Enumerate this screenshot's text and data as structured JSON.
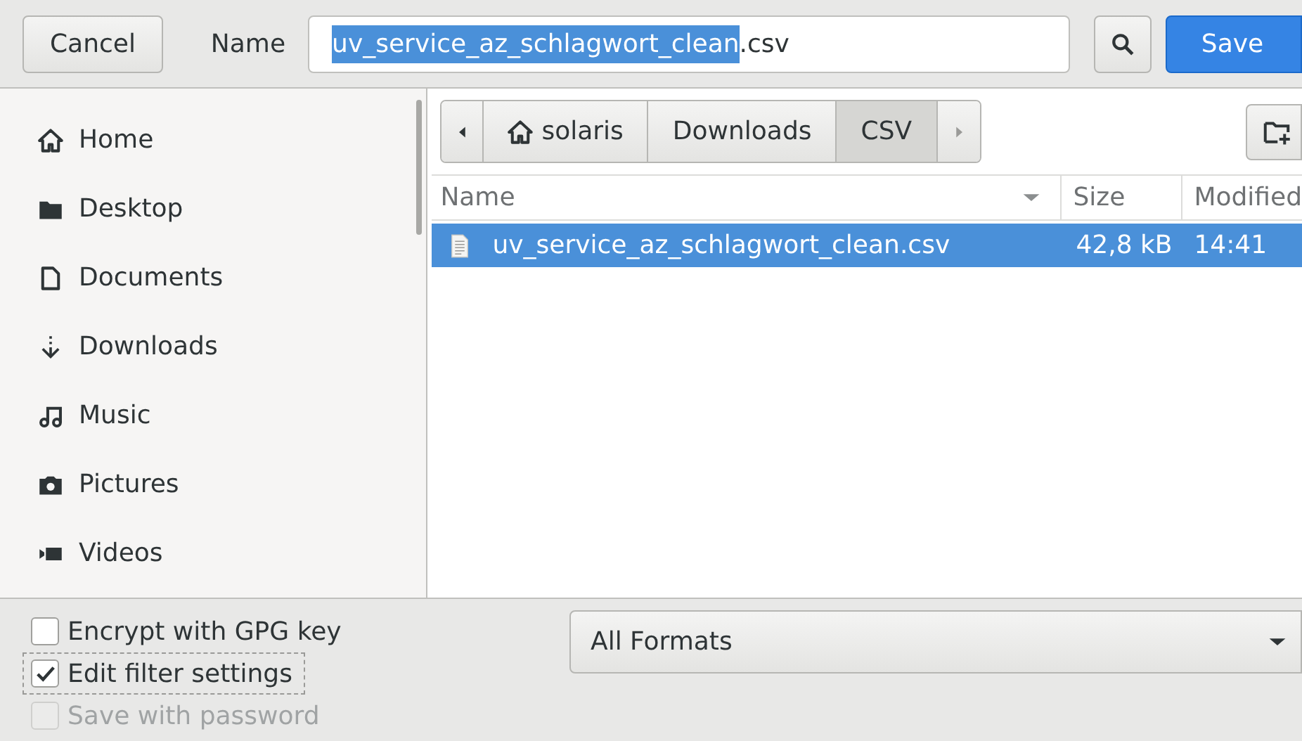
{
  "header": {
    "cancel": "Cancel",
    "name_label": "Name",
    "name_field": {
      "selected_text": "uv_service_az_schlagwort_clean",
      "rest_text": ".csv"
    },
    "save": "Save"
  },
  "sidebar": {
    "items": [
      {
        "label": "Home",
        "kind": "home"
      },
      {
        "label": "Desktop",
        "kind": "folder"
      },
      {
        "label": "Documents",
        "kind": "document"
      },
      {
        "label": "Downloads",
        "kind": "download"
      },
      {
        "label": "Music",
        "kind": "music"
      },
      {
        "label": "Pictures",
        "kind": "camera"
      },
      {
        "label": "Videos",
        "kind": "video"
      }
    ]
  },
  "path_bar": {
    "segments": [
      {
        "label": "solaris",
        "kind": "home",
        "selected": false
      },
      {
        "label": "Downloads",
        "kind": "folder",
        "selected": false
      },
      {
        "label": "CSV",
        "kind": "folder",
        "selected": true
      }
    ]
  },
  "file_list": {
    "columns": [
      "Name",
      "Size",
      "Modified"
    ],
    "rows": [
      {
        "name": "uv_service_az_schlagwort_clean.csv",
        "size": "42,8 kB",
        "modified": "14:41",
        "selected": true
      }
    ]
  },
  "options": [
    {
      "label": "Encrypt with GPG key",
      "checked": false,
      "disabled": false,
      "focused": false
    },
    {
      "label": "Edit filter settings",
      "checked": true,
      "disabled": false,
      "focused": true
    },
    {
      "label": "Save with password",
      "checked": false,
      "disabled": true,
      "focused": false
    }
  ],
  "filter": {
    "value": "All Formats"
  }
}
